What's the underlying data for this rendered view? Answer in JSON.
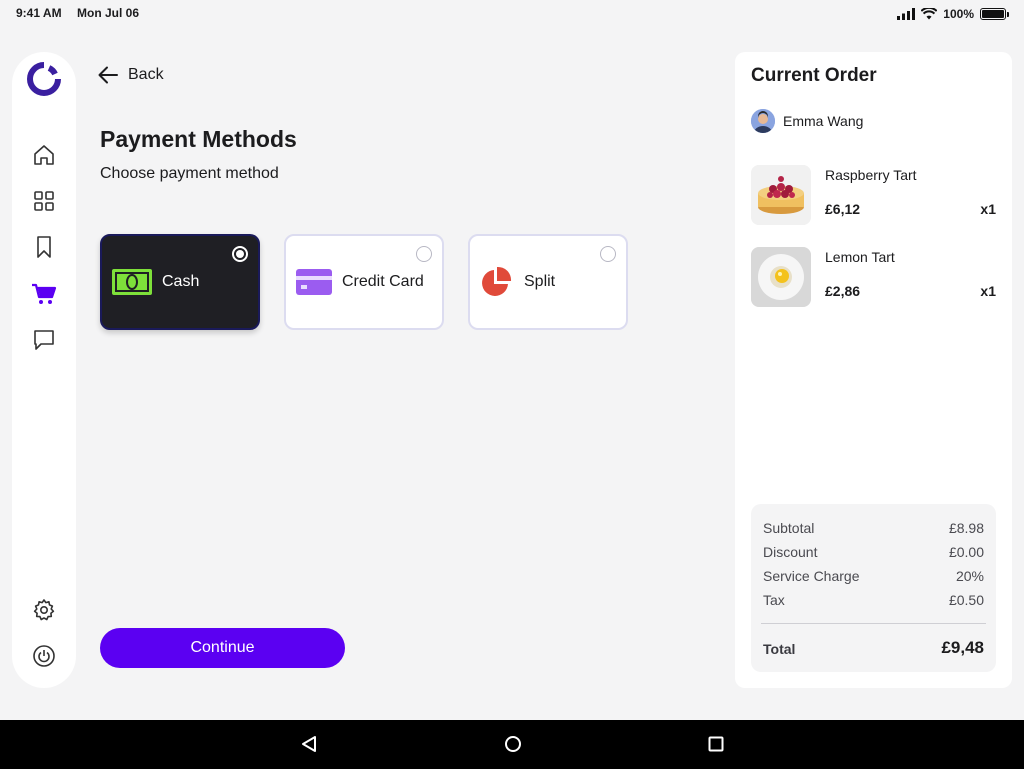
{
  "status_bar": {
    "time": "9:41 AM",
    "date": "Mon Jul 06",
    "battery": "100%"
  },
  "sidebar": {
    "items": [
      {
        "icon": "home-icon"
      },
      {
        "icon": "grid-icon"
      },
      {
        "icon": "bookmark-icon"
      },
      {
        "icon": "cart-icon",
        "active": true
      },
      {
        "icon": "chat-icon"
      },
      {
        "icon": "gear-icon"
      },
      {
        "icon": "power-icon"
      }
    ],
    "accent_color": "#5b00f2"
  },
  "header": {
    "back_label": "Back",
    "title": "Payment Methods",
    "subtitle": "Choose payment method"
  },
  "payment_methods": [
    {
      "label": "Cash",
      "icon": "cash-icon",
      "selected": true
    },
    {
      "label": "Credit Card",
      "icon": "credit-card-icon",
      "selected": false
    },
    {
      "label": "Split",
      "icon": "pie-chart-icon",
      "selected": false
    }
  ],
  "continue_label": "Continue",
  "order": {
    "title": "Current Order",
    "customer": "Emma Wang",
    "items": [
      {
        "name": "Raspberry Tart",
        "price": "£6,12",
        "qty": "x1"
      },
      {
        "name": "Lemon Tart",
        "price": "£2,86",
        "qty": "x1"
      }
    ],
    "summary": [
      {
        "label": "Subtotal",
        "value": "£8.98"
      },
      {
        "label": "Discount",
        "value": "£0.00"
      },
      {
        "label": "Service Charge",
        "value": "20%"
      },
      {
        "label": "Tax",
        "value": "£0.50"
      }
    ],
    "total_label": "Total",
    "total_value": "£9,48"
  }
}
